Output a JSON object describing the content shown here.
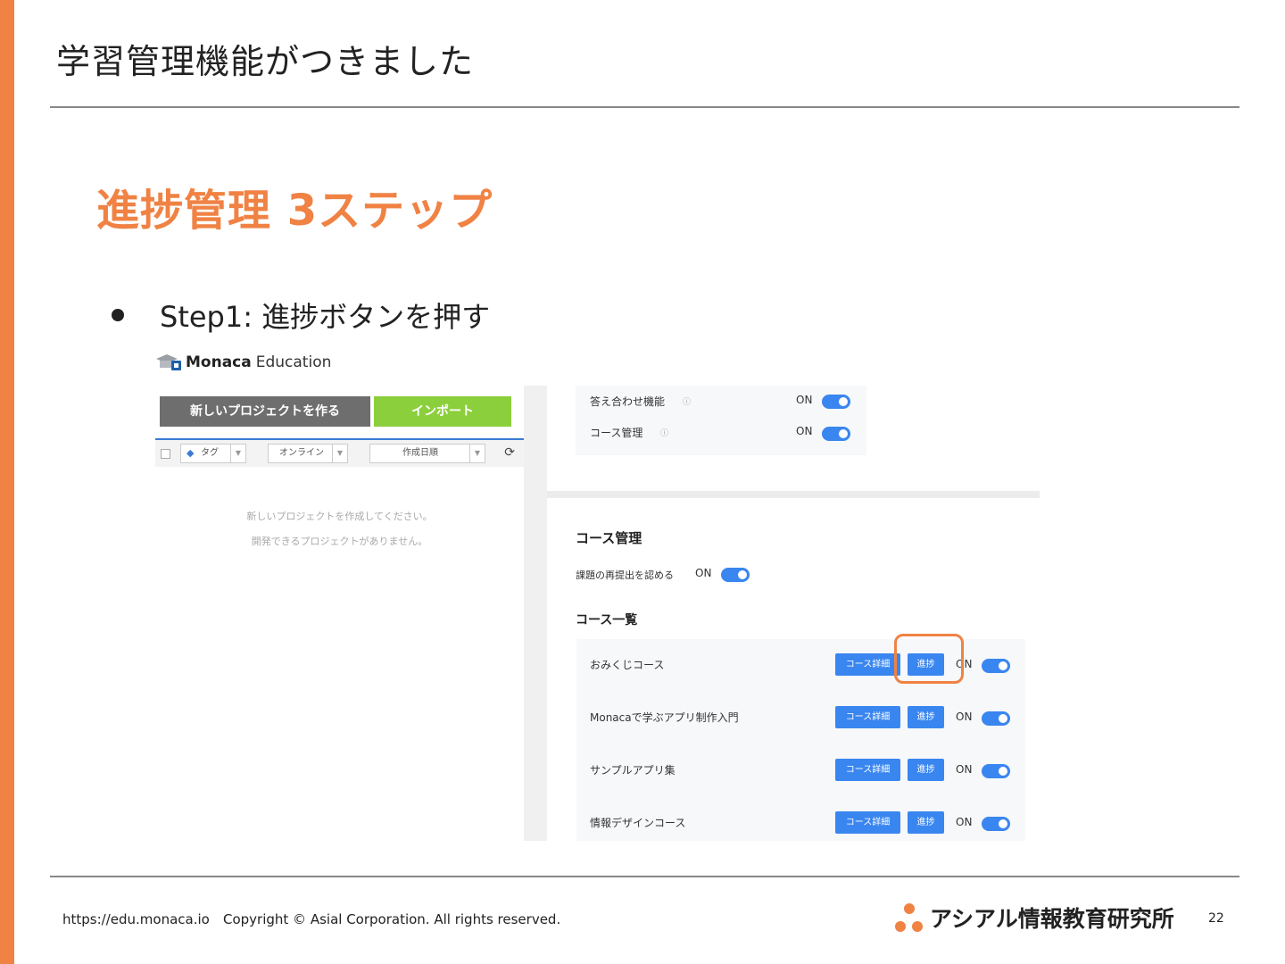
{
  "slide": {
    "title": "学習管理機能がつきました",
    "subtitle": "進捗管理 3ステップ",
    "bullet": "Step1: 進捗ボタンを押す"
  },
  "app": {
    "brand_bold": "Monaca",
    "brand_rest": "Education",
    "new_project_button": "新しいプロジェクトを作る",
    "import_button": "インポート",
    "filter_tag": "タグ",
    "filter_online": "オンライン",
    "filter_sort": "作成日順",
    "empty_line1": "新しいプロジェクトを作成してください。",
    "empty_line2": "開発できるプロジェクトがありません。"
  },
  "settings": {
    "answer_feature_label": "答え合わせ機能",
    "answer_feature_state": "ON",
    "course_manage_label": "コース管理",
    "course_manage_state": "ON"
  },
  "course_section": {
    "title": "コース管理",
    "resubmit_label": "課題の再提出を認める",
    "resubmit_state": "ON",
    "list_title": "コース一覧",
    "detail_label": "コース詳細",
    "progress_label": "進捗",
    "courses": [
      {
        "name": "おみくじコース",
        "state": "ON"
      },
      {
        "name": "Monacaで学ぶアプリ制作入門",
        "state": "ON"
      },
      {
        "name": "サンプルアプリ集",
        "state": "ON"
      },
      {
        "name": "情報デザインコース",
        "state": "ON"
      }
    ]
  },
  "footer": {
    "url": "https://edu.monaca.io",
    "copyright": "Copyright © Asial Corporation. All rights reserved.",
    "brand": "アシアル情報教育研究所",
    "page": "22"
  },
  "colors": {
    "accent": "#f08244",
    "toggle_on": "#3a86f0",
    "import_green": "#8ccf3c",
    "new_project_gray": "#6e6e6e"
  }
}
